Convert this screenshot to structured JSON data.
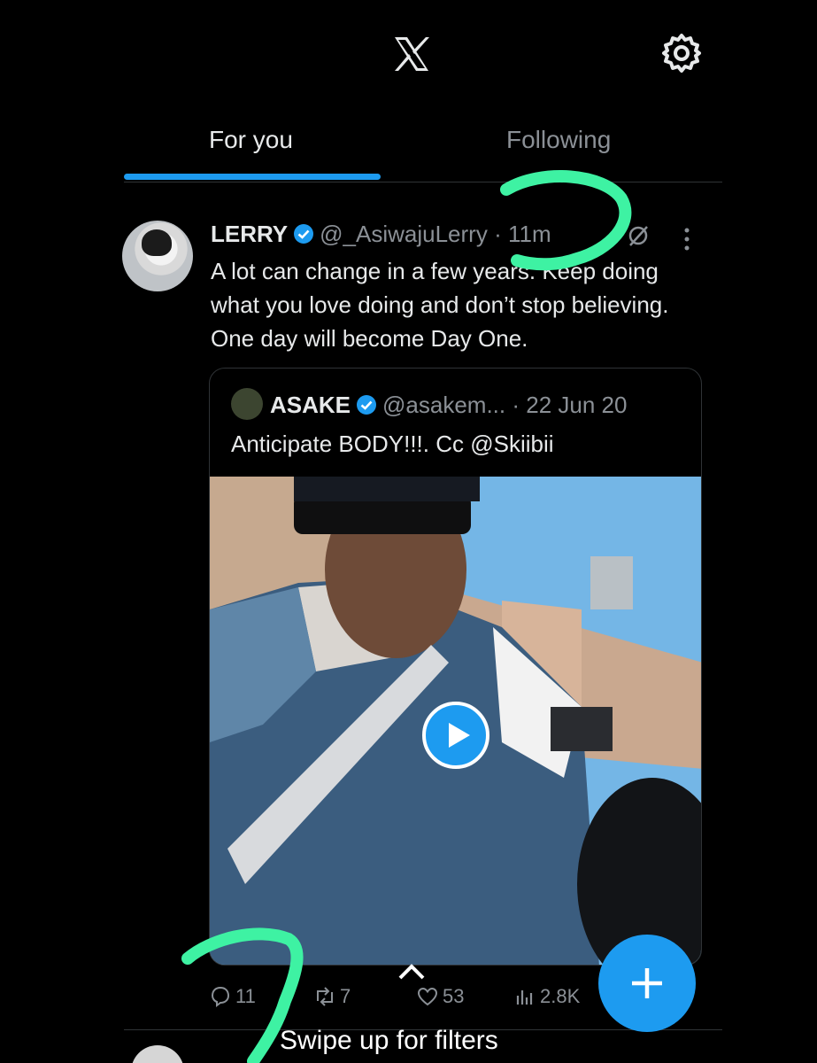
{
  "header": {
    "logo_icon": "x-logo-icon",
    "settings_icon": "gear-icon"
  },
  "tabs": [
    {
      "label": "For you",
      "active": true
    },
    {
      "label": "Following",
      "active": false
    }
  ],
  "tweet": {
    "name": "LERRY",
    "handle": "@_AsiwajuLerry",
    "time": "· 11m",
    "text": "A lot can change in a few years. Keep doing what you love doing and don’t stop believing. One day will become Day One.",
    "quote": {
      "name": "ASAKE",
      "handle": "@asakem...",
      "time": "· 22 Jun 20",
      "text": "Anticipate BODY!!!. Cc @Skiibii"
    },
    "actions": {
      "replies": "11",
      "reposts": "7",
      "likes": "53",
      "views": "2.8K"
    }
  },
  "swipe_hint": "Swipe up for filters",
  "colors": {
    "accent": "#1d9bf0",
    "annotation": "#3ef2a3"
  }
}
